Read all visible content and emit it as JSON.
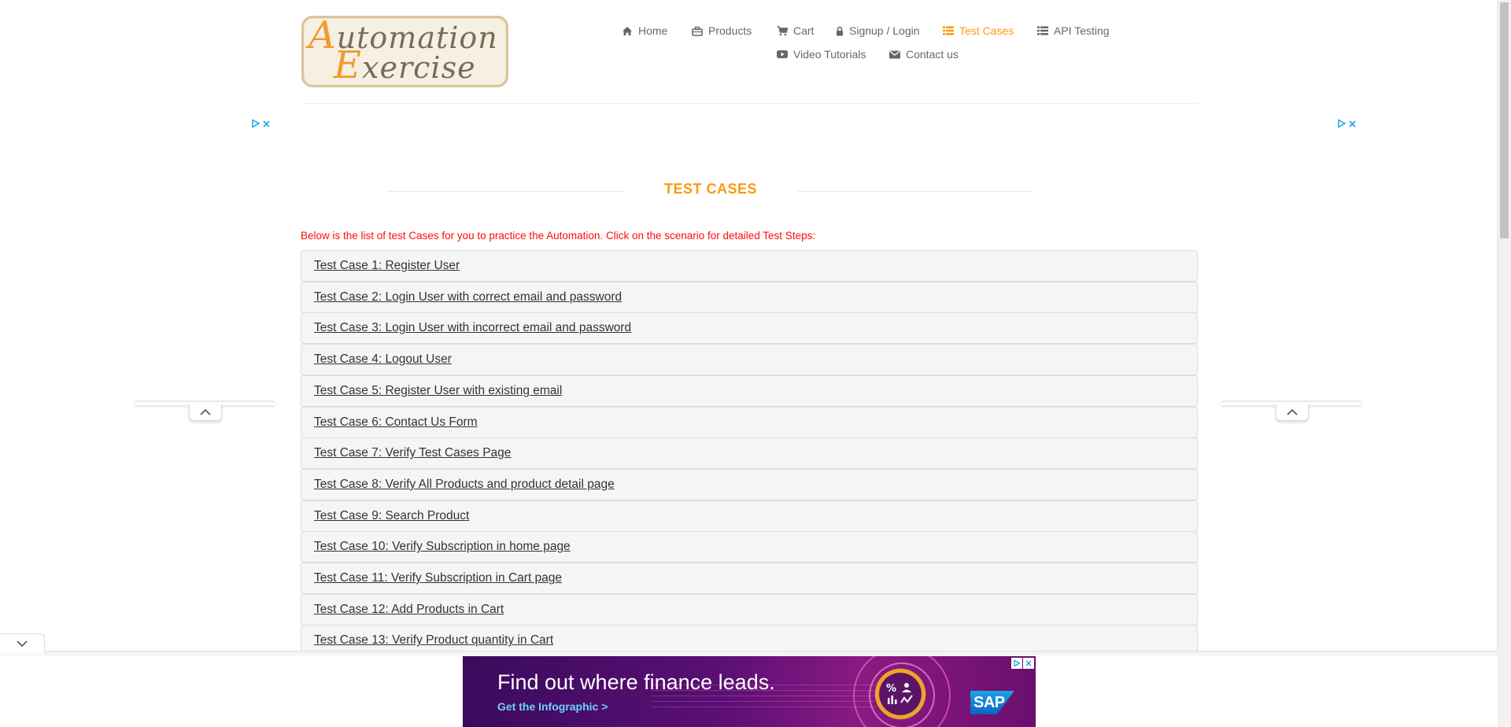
{
  "logo": {
    "line1_cap": "A",
    "line1_rest": "utomation",
    "line2_cap": "E",
    "line2_rest": "xercise"
  },
  "nav": {
    "home": "Home",
    "products": "Products",
    "cart": "Cart",
    "signup_login": "Signup / Login",
    "test_cases": "Test Cases",
    "api_testing": "API Testing",
    "video_tutorials": "Video Tutorials",
    "contact_us": "Contact us"
  },
  "page": {
    "title": "TEST CASES",
    "intro": "Below is the list of test Cases for you to practice the Automation. Click on the scenario for detailed Test Steps:"
  },
  "test_cases": [
    "Test Case 1: Register User",
    "Test Case 2: Login User with correct email and password",
    "Test Case 3: Login User with incorrect email and password",
    "Test Case 4: Logout User",
    "Test Case 5: Register User with existing email",
    "Test Case 6: Contact Us Form",
    "Test Case 7: Verify Test Cases Page",
    "Test Case 8: Verify All Products and product detail page",
    "Test Case 9: Search Product",
    "Test Case 10: Verify Subscription in home page",
    "Test Case 11: Verify Subscription in Cart page",
    "Test Case 12: Add Products in Cart",
    "Test Case 13: Verify Product quantity in Cart"
  ],
  "ad": {
    "headline": "Find out where finance leads.",
    "cta": "Get the Infographic >",
    "brand": "SAP"
  },
  "colors": {
    "accent": "#fe980f",
    "intro_text": "#fe0b0b",
    "nav_text": "#696763",
    "case_bg": "#f5f5f5"
  },
  "icons": {
    "home": "home-icon",
    "products": "briefcase-icon",
    "cart": "shopping-cart-icon",
    "signup_login": "lock-icon",
    "test_cases": "list-icon",
    "api_testing": "list-icon",
    "video_tutorials": "youtube-play-icon",
    "contact_us": "envelope-icon"
  }
}
